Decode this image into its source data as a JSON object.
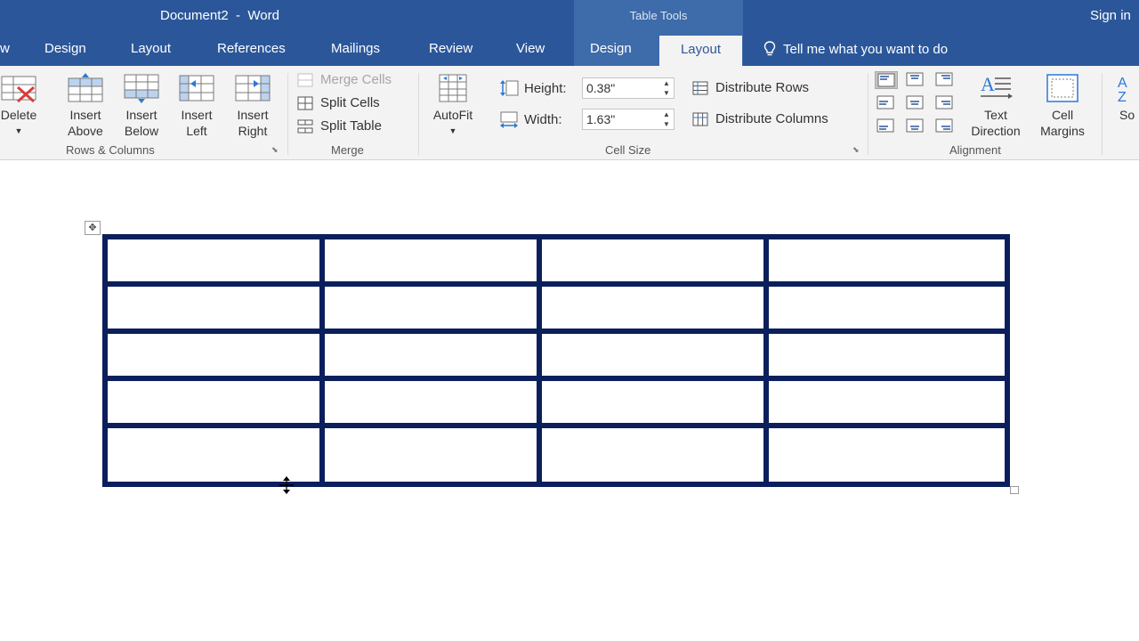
{
  "titlebar": {
    "doc_title": "Document2  -  Word",
    "context_group": "Table Tools",
    "signin": "Sign in"
  },
  "tabs": {
    "partial": "w",
    "design": "Design",
    "layout": "Layout",
    "references": "References",
    "mailings": "Mailings",
    "review": "Review",
    "view": "View",
    "table_design": "Design",
    "table_layout": "Layout",
    "tellme": "Tell me what you want to do"
  },
  "rows_columns": {
    "delete": "Delete",
    "insert_above": [
      "Insert",
      "Above"
    ],
    "insert_below": [
      "Insert",
      "Below"
    ],
    "insert_left": [
      "Insert",
      "Left"
    ],
    "insert_right": [
      "Insert",
      "Right"
    ],
    "group": "Rows & Columns"
  },
  "merge": {
    "merge_cells": "Merge Cells",
    "split_cells": "Split Cells",
    "split_table": "Split Table",
    "group": "Merge"
  },
  "cell_size": {
    "autofit": "AutoFit",
    "height_label": "Height:",
    "height_value": "0.38\"",
    "width_label": "Width:",
    "width_value": "1.63\"",
    "distribute_rows": "Distribute Rows",
    "distribute_columns": "Distribute Columns",
    "group": "Cell Size"
  },
  "alignment": {
    "text_direction": [
      "Text",
      "Direction"
    ],
    "cell_margins": [
      "Cell",
      "Margins"
    ],
    "sort_partial": "So",
    "group": "Alignment"
  },
  "colors": {
    "accent": "#2b579a",
    "table_border": "#0a1f5c"
  },
  "table": {
    "rows": 5,
    "columns": 4
  }
}
